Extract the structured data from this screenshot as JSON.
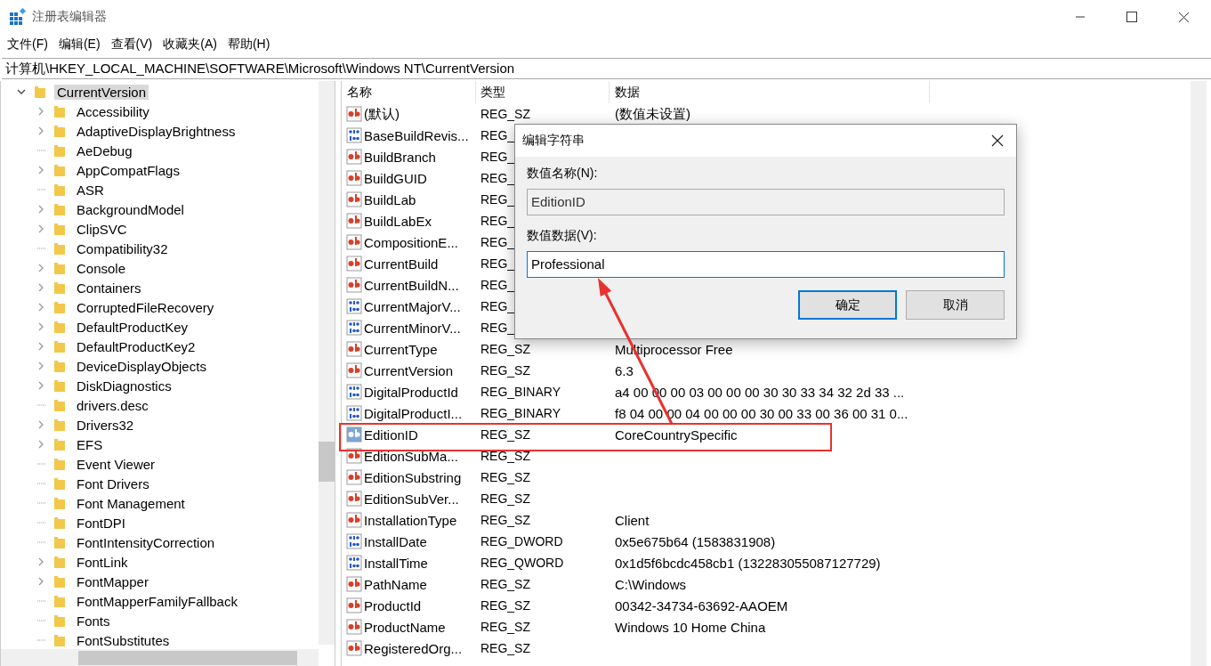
{
  "window": {
    "title": "注册表编辑器"
  },
  "menu": [
    "文件(F)",
    "编辑(E)",
    "查看(V)",
    "收藏夹(A)",
    "帮助(H)"
  ],
  "address": "计算机\\HKEY_LOCAL_MACHINE\\SOFTWARE\\Microsoft\\Windows NT\\CurrentVersion",
  "tree": {
    "label": "CurrentVersion",
    "expanded": true,
    "selected": true,
    "children": [
      {
        "label": "Accessibility",
        "expandable": true
      },
      {
        "label": "AdaptiveDisplayBrightness",
        "expandable": true
      },
      {
        "label": "AeDebug",
        "expandable": false
      },
      {
        "label": "AppCompatFlags",
        "expandable": true
      },
      {
        "label": "ASR",
        "expandable": false
      },
      {
        "label": "BackgroundModel",
        "expandable": true
      },
      {
        "label": "ClipSVC",
        "expandable": true
      },
      {
        "label": "Compatibility32",
        "expandable": false
      },
      {
        "label": "Console",
        "expandable": true
      },
      {
        "label": "Containers",
        "expandable": true
      },
      {
        "label": "CorruptedFileRecovery",
        "expandable": true
      },
      {
        "label": "DefaultProductKey",
        "expandable": true
      },
      {
        "label": "DefaultProductKey2",
        "expandable": true
      },
      {
        "label": "DeviceDisplayObjects",
        "expandable": true
      },
      {
        "label": "DiskDiagnostics",
        "expandable": true
      },
      {
        "label": "drivers.desc",
        "expandable": false
      },
      {
        "label": "Drivers32",
        "expandable": true
      },
      {
        "label": "EFS",
        "expandable": true
      },
      {
        "label": "Event Viewer",
        "expandable": false
      },
      {
        "label": "Font Drivers",
        "expandable": false
      },
      {
        "label": "Font Management",
        "expandable": false
      },
      {
        "label": "FontDPI",
        "expandable": false
      },
      {
        "label": "FontIntensityCorrection",
        "expandable": false
      },
      {
        "label": "FontLink",
        "expandable": true
      },
      {
        "label": "FontMapper",
        "expandable": true
      },
      {
        "label": "FontMapperFamilyFallback",
        "expandable": false
      },
      {
        "label": "Fonts",
        "expandable": false
      },
      {
        "label": "FontSubstitutes",
        "expandable": false
      }
    ]
  },
  "table": {
    "columns": [
      "名称",
      "类型",
      "数据"
    ],
    "rows": [
      {
        "kind": "string",
        "name": "(默认)",
        "type": "REG_SZ",
        "data": "(数值未设置)",
        "selected": false
      },
      {
        "kind": "binary",
        "name": "BaseBuildRevis...",
        "type": "REG_",
        "selected": false
      },
      {
        "kind": "string",
        "name": "BuildBranch",
        "type": "REG_",
        "selected": false
      },
      {
        "kind": "string",
        "name": "BuildGUID",
        "type": "REG_",
        "selected": false
      },
      {
        "kind": "string",
        "name": "BuildLab",
        "type": "REG_",
        "selected": false
      },
      {
        "kind": "string",
        "name": "BuildLabEx",
        "type": "REG_",
        "selected": false
      },
      {
        "kind": "string",
        "name": "CompositionE...",
        "type": "REG_",
        "selected": false
      },
      {
        "kind": "string",
        "name": "CurrentBuild",
        "type": "REG_",
        "selected": false
      },
      {
        "kind": "string",
        "name": "CurrentBuildN...",
        "type": "REG_",
        "selected": false
      },
      {
        "kind": "binary",
        "name": "CurrentMajorV...",
        "type": "REG_",
        "selected": false
      },
      {
        "kind": "binary",
        "name": "CurrentMinorV...",
        "type": "REG_",
        "selected": false
      },
      {
        "kind": "string",
        "name": "CurrentType",
        "type": "REG_SZ",
        "data": "Multiprocessor Free",
        "selected": false
      },
      {
        "kind": "string",
        "name": "CurrentVersion",
        "type": "REG_SZ",
        "data": "6.3",
        "selected": false
      },
      {
        "kind": "binary",
        "name": "DigitalProductId",
        "type": "REG_BINARY",
        "data": "a4 00 00 00 03 00 00 00 30 30 33 34 32 2d 33 ...",
        "selected": false
      },
      {
        "kind": "binary",
        "name": "DigitalProductI...",
        "type": "REG_BINARY",
        "data": "f8 04 00 00 04 00 00 00 30 00 33 00 36 00 31 0...",
        "selected": false
      },
      {
        "kind": "string",
        "name": "EditionID",
        "type": "REG_SZ",
        "data": "CoreCountrySpecific",
        "selected": true
      },
      {
        "kind": "string",
        "name": "EditionSubMa...",
        "type": "REG_SZ",
        "selected": false
      },
      {
        "kind": "string",
        "name": "EditionSubstring",
        "type": "REG_SZ",
        "selected": false
      },
      {
        "kind": "string",
        "name": "EditionSubVer...",
        "type": "REG_SZ",
        "selected": false
      },
      {
        "kind": "string",
        "name": "InstallationType",
        "type": "REG_SZ",
        "data": "Client",
        "selected": false
      },
      {
        "kind": "binary",
        "name": "InstallDate",
        "type": "REG_DWORD",
        "data": "0x5e675b64 (1583831908)",
        "selected": false
      },
      {
        "kind": "binary",
        "name": "InstallTime",
        "type": "REG_QWORD",
        "data": "0x1d5f6bcdc458cb1 (132283055087127729)",
        "selected": false
      },
      {
        "kind": "string",
        "name": "PathName",
        "type": "REG_SZ",
        "data": "C:\\Windows",
        "selected": false
      },
      {
        "kind": "string",
        "name": "ProductId",
        "type": "REG_SZ",
        "data": "00342-34734-63692-AAOEM",
        "selected": false
      },
      {
        "kind": "string",
        "name": "ProductName",
        "type": "REG_SZ",
        "data": "Windows 10 Home China",
        "selected": false
      },
      {
        "kind": "string",
        "name": "RegisteredOrg...",
        "type": "REG_SZ",
        "selected": false
      }
    ]
  },
  "dialog": {
    "title": "编辑字符串",
    "name_label": "数值名称(N):",
    "name_value": "EditionID",
    "data_label": "数值数据(V):",
    "data_value": "Professional",
    "buttons": [
      {
        "label": "确定",
        "default": true
      },
      {
        "label": "取消",
        "default": false
      }
    ]
  }
}
